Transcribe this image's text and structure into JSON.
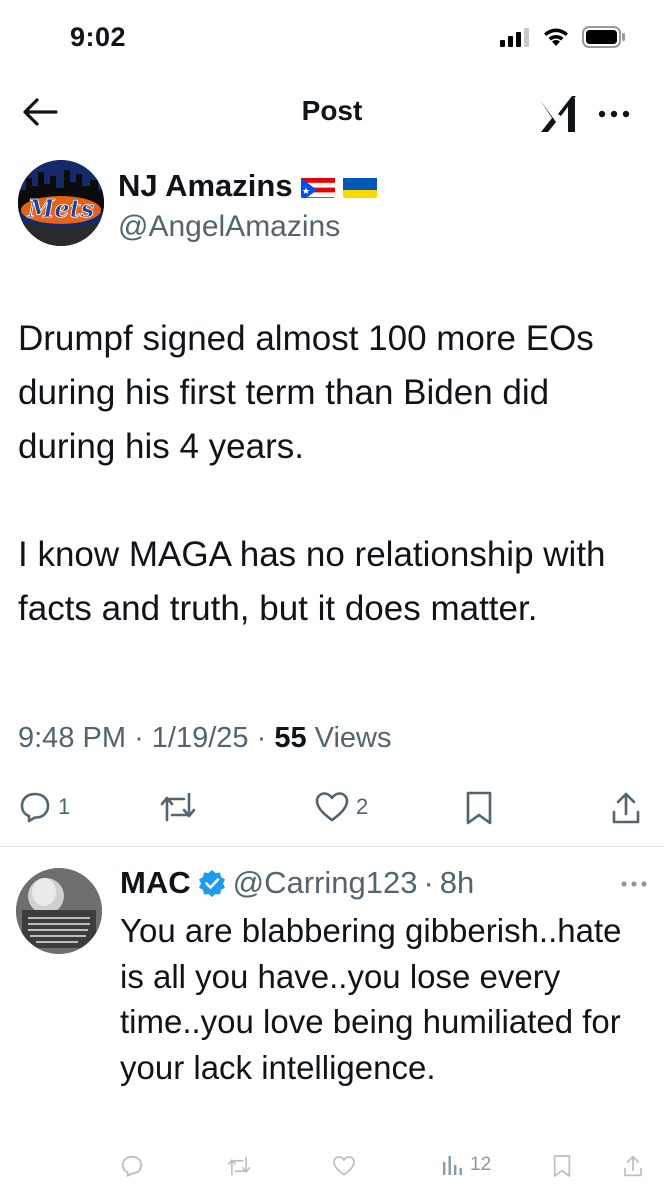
{
  "status_bar": {
    "time": "9:02"
  },
  "nav": {
    "title": "Post"
  },
  "tweet": {
    "author_name": "NJ Amazins",
    "author_handle": "@AngelAmazins",
    "avatar_text": "Mets",
    "paragraph_1": "Drumpf signed almost 100 more EOs during his first term than Biden did during his 4 years.",
    "paragraph_2": "I know MAGA has no relationship with facts and truth, but it does matter.",
    "time": "9:48 PM",
    "date": "1/19/25",
    "views_count": "55",
    "views_label": "Views",
    "reply_count": "1",
    "like_count": "2"
  },
  "reply": {
    "author_name": "MAC",
    "author_handle": "@Carring123",
    "age": "8h",
    "text": "You are blabbering gibberish..hate is all you have..you lose every time..you love being humiliated for your lack intelligence.",
    "views_count": "12"
  },
  "icons": {
    "back": "arrow-left-icon",
    "grok": "grok-icon",
    "more": "more-dots-icon",
    "reply": "reply-bubble-icon",
    "repost": "repost-icon",
    "like": "heart-icon",
    "bookmark": "bookmark-icon",
    "share": "share-icon",
    "views": "views-bar-icon",
    "verified": "verified-badge-icon"
  },
  "colors": {
    "text": "#0f1419",
    "secondary": "#536471",
    "verified": "#1d9bf0",
    "divider": "#e1e5e8"
  }
}
